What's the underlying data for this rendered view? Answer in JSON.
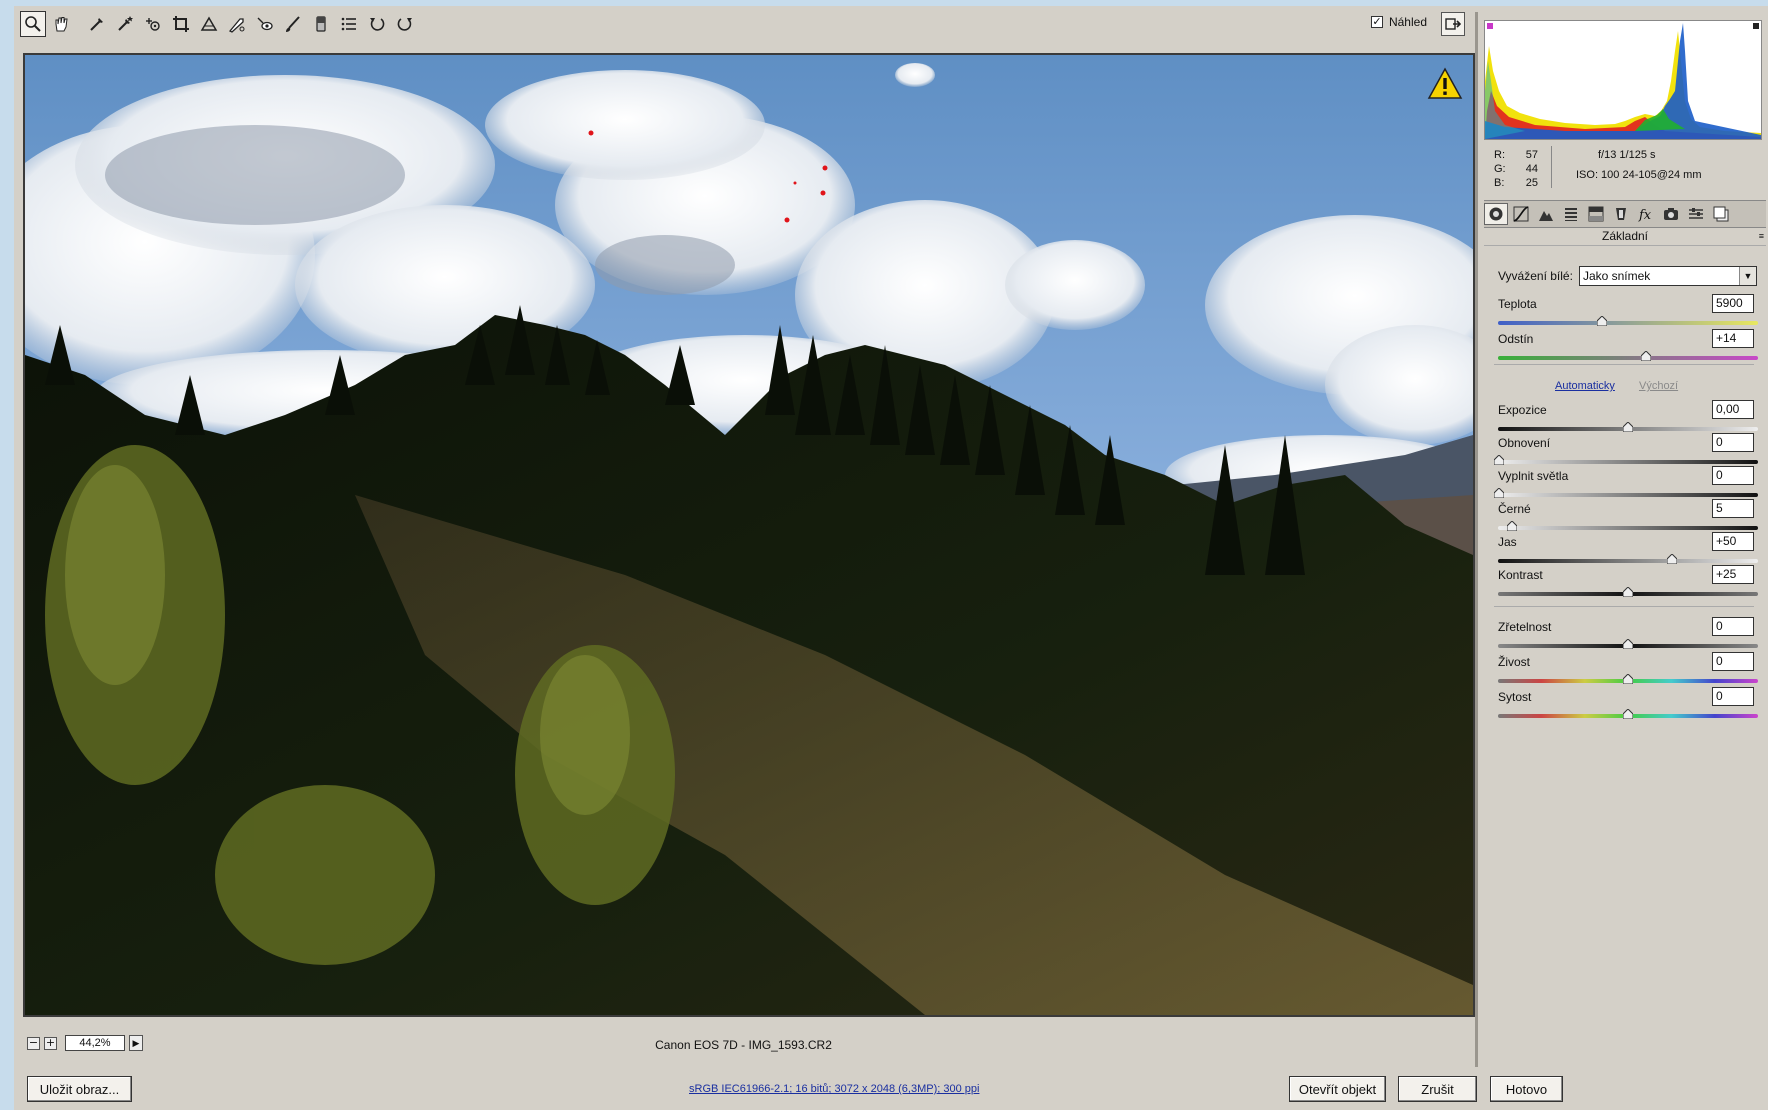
{
  "toolbar": {
    "tools": [
      "zoom-tool",
      "hand-tool",
      "white-balance-tool",
      "color-sampler-tool",
      "targeted-adjustment-tool",
      "crop-tool",
      "straighten-tool",
      "spot-removal-tool",
      "red-eye-removal-tool",
      "adjustment-brush-tool",
      "graduated-filter-tool",
      "preferences-tool",
      "rotate-ccw-tool",
      "rotate-cw-tool"
    ],
    "preview_label": "Náhled",
    "preview_checked": "✓"
  },
  "image": {
    "clipping_warning_icon": "warning-icon"
  },
  "status": {
    "zoom_minus": "−",
    "zoom_plus": "+",
    "zoom_value": "44,2%",
    "zoom_arrow": "▶",
    "filename": "Canon EOS 7D  -  IMG_1593.CR2"
  },
  "bottom": {
    "save_label": "Uložit obraz...",
    "workflow_link": "sRGB IEC61966-2.1; 16 bitů; 3072 x 2048 (6,3MP); 300 ppi",
    "open_label": "Otevřít objekt",
    "cancel_label": "Zrušit",
    "done_label": "Hotovo"
  },
  "readout": {
    "r_label": "R:",
    "r_value": "57",
    "g_label": "G:",
    "g_value": "44",
    "b_label": "B:",
    "b_value": "25",
    "aperture_shutter": "f/13   1/125 s",
    "iso_lens": "ISO: 100   24-105@24 mm"
  },
  "panel": {
    "tabs": [
      "basic-icon",
      "tone-curve-icon",
      "detail-icon",
      "hsl-icon",
      "split-toning-icon",
      "lens-corrections-icon",
      "effects-icon",
      "camera-calibration-icon",
      "presets-icon",
      "snapshots-icon"
    ],
    "title": "Základní",
    "wb_label": "Vyvážení bílé:",
    "wb_value": "Jako snímek",
    "auto": "Automaticky",
    "default": "Výchozí",
    "sliders": {
      "temperature": {
        "label": "Teplota",
        "value": "5900",
        "level": 0.4
      },
      "tint": {
        "label": "Odstín",
        "value": "+14",
        "level": 0.57
      },
      "exposure": {
        "label": "Expozice",
        "value": "0,00",
        "level": 0.5
      },
      "recovery": {
        "label": "Obnovení",
        "value": "0",
        "level": 0.0
      },
      "fill_light": {
        "label": "Vyplnit světla",
        "value": "0",
        "level": 0.0
      },
      "blacks": {
        "label": "Černé",
        "value": "5",
        "level": 0.05
      },
      "brightness": {
        "label": "Jas",
        "value": "+50",
        "level": 0.67
      },
      "contrast": {
        "label": "Kontrast",
        "value": "+25",
        "level": 0.5
      },
      "clarity": {
        "label": "Zřetelnost",
        "value": "0",
        "level": 0.5
      },
      "vibrance": {
        "label": "Živost",
        "value": "0",
        "level": 0.5
      },
      "saturation": {
        "label": "Sytost",
        "value": "0",
        "level": 0.5
      }
    }
  }
}
